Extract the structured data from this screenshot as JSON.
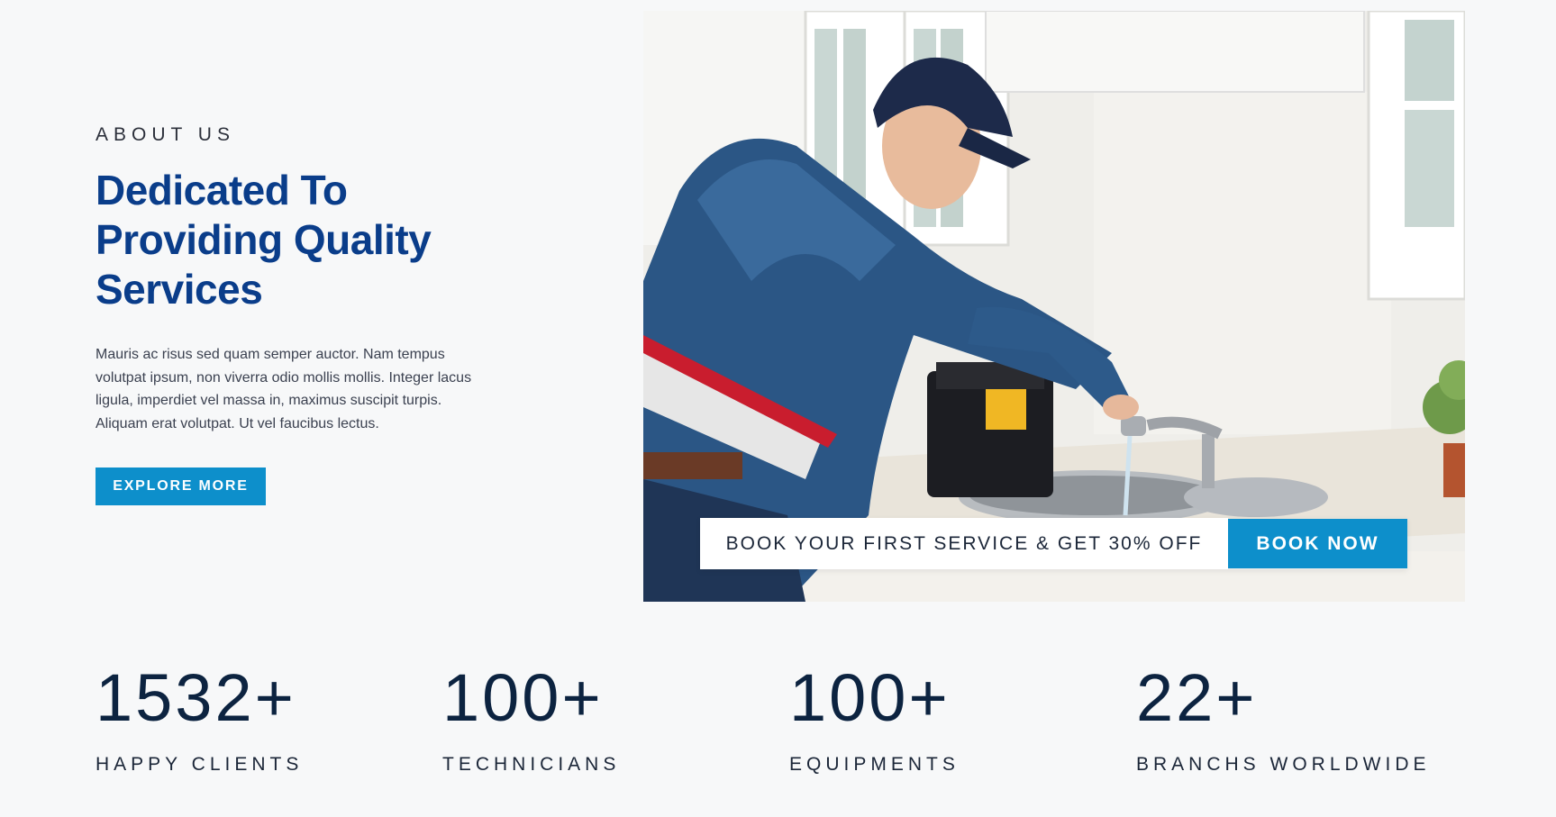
{
  "about": {
    "eyebrow": "ABOUT US",
    "heading": "Dedicated To Providing Quality Services",
    "body": "Mauris ac risus sed quam semper auctor. Nam tempus volutpat ipsum, non viverra odio mollis mollis. Integer lacus ligula, imperdiet vel massa in, maximus suscipit turpis. Aliquam erat volutpat. Ut vel faucibus lectus.",
    "cta_label": "EXPLORE MORE"
  },
  "promo": {
    "text": "BOOK YOUR FIRST SERVICE & GET 30% OFF",
    "button_label": "BOOK NOW"
  },
  "stats": [
    {
      "number": "1532+",
      "label": "HAPPY CLIENTS"
    },
    {
      "number": "100+",
      "label": "TECHNICIANS"
    },
    {
      "number": "100+",
      "label": "EQUIPMENTS"
    },
    {
      "number": "22+",
      "label": "BRANCHS WORLDWIDE"
    }
  ],
  "colors": {
    "accent": "#0d8fcb",
    "heading": "#0a3d8a",
    "text_dark": "#0c2340",
    "background": "#f7f8f9"
  }
}
